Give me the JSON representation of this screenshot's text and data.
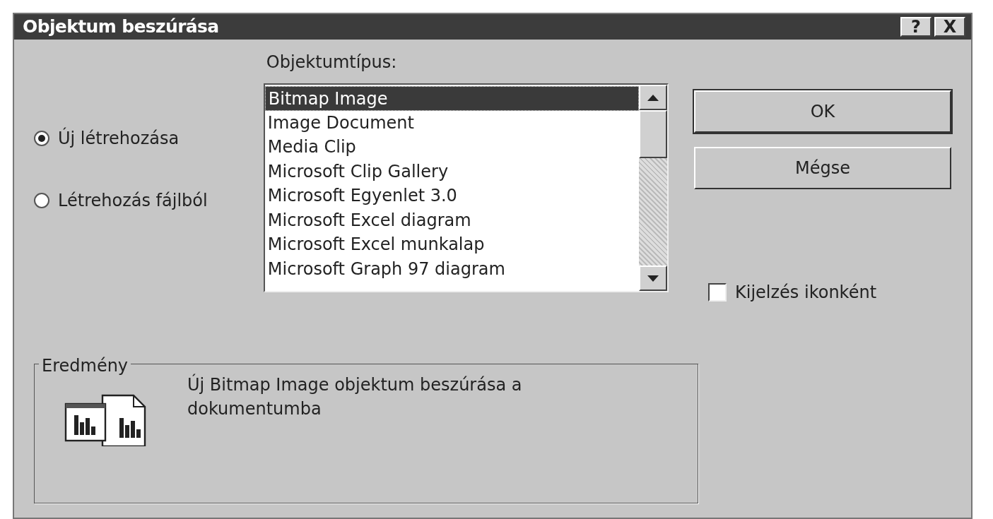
{
  "window": {
    "title": "Objektum beszúrása",
    "controls": [
      {
        "kind": "help",
        "label": "?"
      },
      {
        "kind": "close",
        "label": "X"
      }
    ]
  },
  "mode_options": [
    {
      "label": "Új létrehozása",
      "selected": true
    },
    {
      "label": "Létrehozás fájlból",
      "selected": false
    }
  ],
  "object_type": {
    "label": "Objektumtípus:",
    "items": [
      {
        "label": "Bitmap Image",
        "selected": true
      },
      {
        "label": "Image Document",
        "selected": false
      },
      {
        "label": "Media Clip",
        "selected": false
      },
      {
        "label": "Microsoft Clip Gallery",
        "selected": false
      },
      {
        "label": "Microsoft Egyenlet 3.0",
        "selected": false
      },
      {
        "label": "Microsoft Excel diagram",
        "selected": false
      },
      {
        "label": "Microsoft Excel munkalap",
        "selected": false
      },
      {
        "label": "Microsoft Graph 97 diagram",
        "selected": false
      }
    ]
  },
  "buttons": [
    "OK",
    "Mégse"
  ],
  "display_as_icon": {
    "label": "Kijelzés ikonként",
    "checked": false
  },
  "result": {
    "title": "Eredmény",
    "text": "Új Bitmap Image objektum beszúrása a dokumentumba"
  }
}
